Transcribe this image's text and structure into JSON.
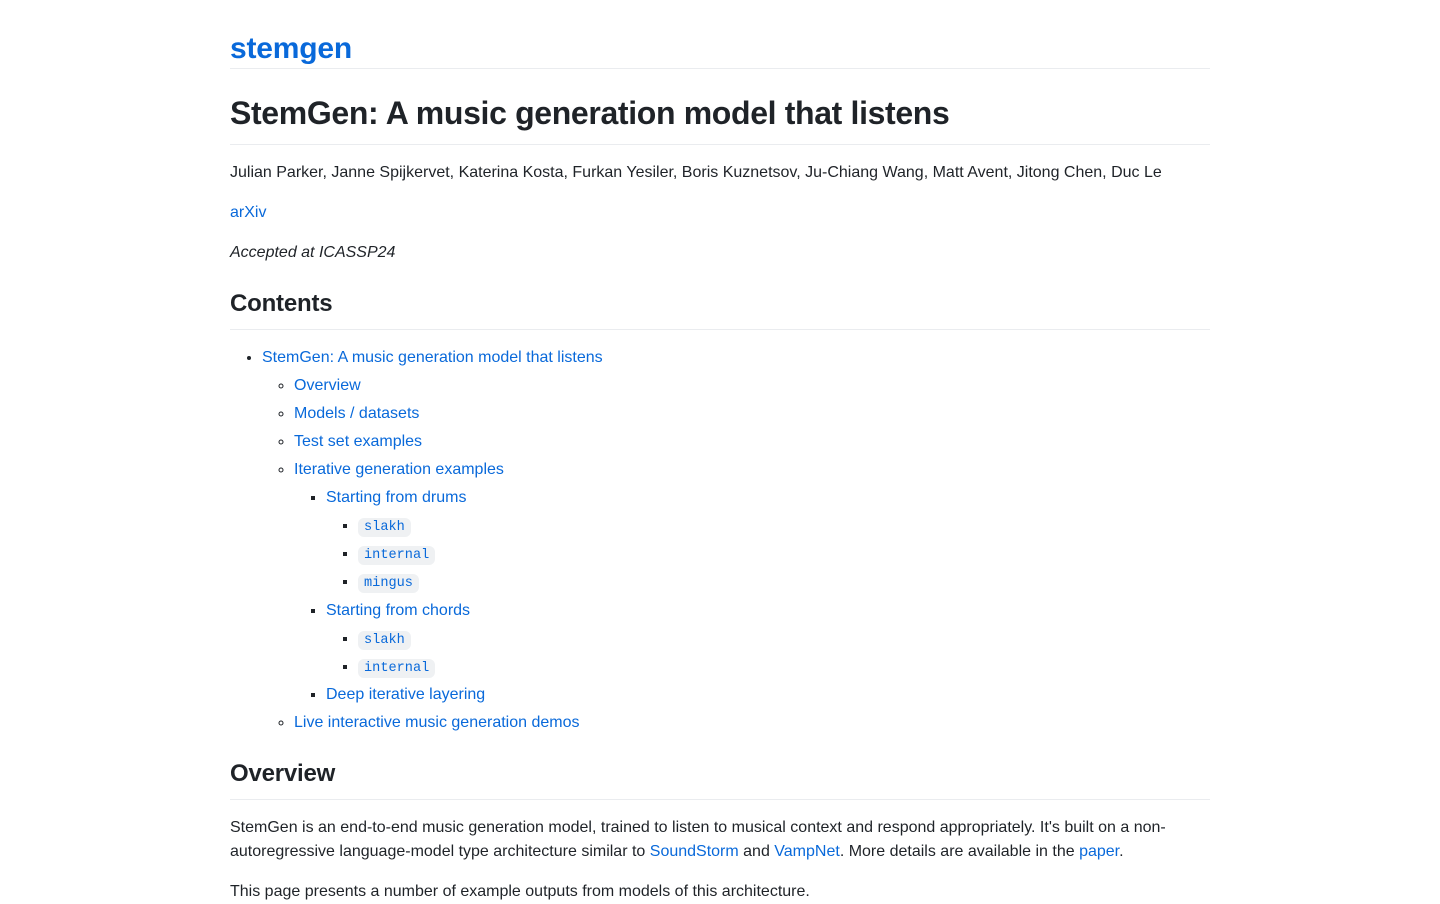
{
  "site": {
    "title": "stemgen"
  },
  "paper": {
    "title": "StemGen: A music generation model that listens",
    "authors": "Julian Parker, Janne Spijkervet, Katerina Kosta, Furkan Yesiler, Boris Kuznetsov, Ju-Chiang Wang, Matt Avent, Jitong Chen, Duc Le",
    "arxiv_label": "arXiv",
    "acceptance_note": "Accepted at ICASSP24"
  },
  "contents": {
    "heading": "Contents",
    "items": [
      {
        "label": "StemGen: A music generation model that listens",
        "children": [
          {
            "label": "Overview"
          },
          {
            "label": "Models / datasets"
          },
          {
            "label": "Test set examples"
          },
          {
            "label": "Iterative generation examples",
            "children": [
              {
                "label": "Starting from drums",
                "children": [
                  {
                    "label": "slakh",
                    "code": true
                  },
                  {
                    "label": "internal",
                    "code": true
                  },
                  {
                    "label": "mingus",
                    "code": true
                  }
                ]
              },
              {
                "label": "Starting from chords",
                "children": [
                  {
                    "label": "slakh",
                    "code": true
                  },
                  {
                    "label": "internal",
                    "code": true
                  }
                ]
              },
              {
                "label": "Deep iterative layering"
              }
            ]
          },
          {
            "label": "Live interactive music generation demos"
          }
        ]
      }
    ]
  },
  "overview": {
    "heading": "Overview",
    "paragraph1": {
      "part1": "StemGen is an end-to-end music generation model, trained to listen to musical context and respond appropriately. It's built on a non-autoregressive language-model type architecture similar to ",
      "link1": "SoundStorm",
      "part2": " and ",
      "link2": "VampNet",
      "part3": ". More details are available in the ",
      "link3": "paper",
      "part4": "."
    },
    "paragraph2": "This page presents a number of example outputs from models of this architecture."
  },
  "colors": {
    "link": "#0969da",
    "text": "#1f2328",
    "rule": "#eaecef",
    "code_bg": "#eff1f3"
  }
}
